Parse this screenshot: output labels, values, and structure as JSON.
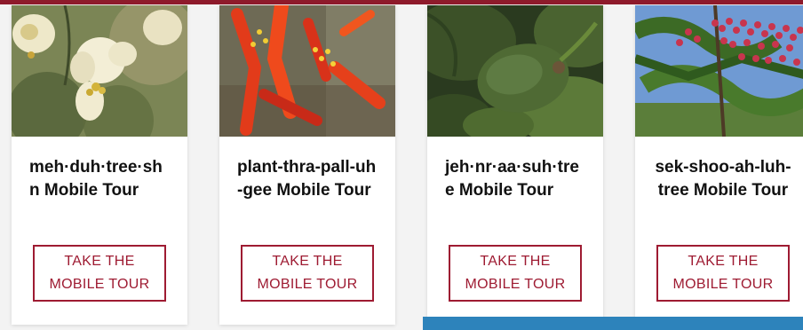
{
  "cards": [
    {
      "title": "meh·duh·tree·shn Mobile Tour",
      "button_line1": "TAKE THE",
      "button_line2": "MOBILE TOUR",
      "image_subject": "white-flower-photo"
    },
    {
      "title": "plant-thra-pall-uh-gee Mobile Tour",
      "button_line1": "TAKE THE",
      "button_line2": "MOBILE TOUR",
      "image_subject": "red-tubular-flower-photo"
    },
    {
      "title": "jeh·nr·aa·suh·tree Mobile Tour",
      "button_line1": "TAKE THE",
      "button_line2": "MOBILE TOUR",
      "image_subject": "green-fig-photo"
    },
    {
      "title": "sek-shoo-ah-luh-tree Mobile Tour",
      "button_line1": "TAKE THE",
      "button_line2": "MOBILE TOUR",
      "image_subject": "red-berry-tree-photo"
    }
  ],
  "colors": {
    "accent": "#9e1b32",
    "top_rule": "#8e1a2b",
    "bottom_bar": "#2d83bb"
  }
}
